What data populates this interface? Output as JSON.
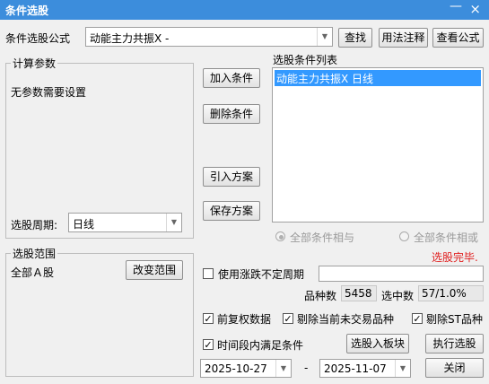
{
  "window": {
    "title": "条件选股",
    "minimize_glyph": "—",
    "close_glyph": "×"
  },
  "formula": {
    "label": "条件选股公式",
    "value": "动能主力共振X  -",
    "find_btn": "查找",
    "usage_btn": "用法注释",
    "view_btn": "查看公式"
  },
  "params": {
    "group_title": "计算参数",
    "note": "无参数需要设置",
    "period_label": "选股周期:",
    "period_value": "日线"
  },
  "actions": {
    "add": "加入条件",
    "delete": "删除条件",
    "import": "引入方案",
    "save": "保存方案"
  },
  "conditions": {
    "title": "选股条件列表",
    "items": [
      "动能主力共振X  日线"
    ]
  },
  "logic": {
    "and_label": "全部条件相与",
    "or_label": "全部条件相或",
    "selected": "and"
  },
  "status": {
    "text": "选股完毕.",
    "color": "#e02020"
  },
  "scope": {
    "group_title": "选股范围",
    "value": "全部Ａ股",
    "change_btn": "改变范围"
  },
  "volatile": {
    "label": "使用涨跌不定周期",
    "checked": false,
    "value": ""
  },
  "counts": {
    "total_label": "品种数",
    "total_value": "5458",
    "hit_label": "选中数",
    "hit_value": "57/1.0%"
  },
  "options": {
    "fq": {
      "label": "前复权数据",
      "checked": true
    },
    "exclude_untraded": {
      "label": "剔除当前未交易品种",
      "checked": true
    },
    "exclude_st": {
      "label": "剔除ST品种",
      "checked": true
    },
    "period_cond": {
      "label": "时间段内满足条件",
      "checked": true
    }
  },
  "dates": {
    "from": "2025-10-27",
    "separator": "-",
    "to": "2025-11-07"
  },
  "bottom": {
    "to_block": "选股入板块",
    "run": "执行选股",
    "close": "关闭"
  },
  "icons": {
    "dropdown": "chevron-down-icon",
    "check": "✓"
  },
  "colors": {
    "titlebar": "#3c8ddc",
    "selection": "#3399ff"
  }
}
